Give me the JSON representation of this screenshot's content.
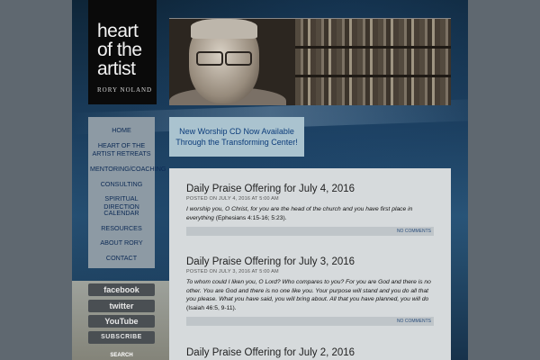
{
  "logo": {
    "title": "heart\nof the\nartist",
    "subtitle": "RORY NOLAND"
  },
  "nav": {
    "items": [
      {
        "label": "HOME"
      },
      {
        "label": "HEART OF THE ARTIST RETREATS"
      },
      {
        "label": "MENTORING/COACHING"
      },
      {
        "label": "CONSULTING"
      },
      {
        "label": "SPIRITUAL DIRECTION"
      },
      {
        "label": "CALENDAR"
      },
      {
        "label": "RESOURCES"
      },
      {
        "label": "ABOUT RORY"
      },
      {
        "label": "CONTACT"
      }
    ]
  },
  "social": {
    "facebook": "facebook",
    "twitter": "twitter",
    "youtube": "YouTube",
    "subscribe": "SUBSCRIBE",
    "search": "SEARCH"
  },
  "promo": {
    "line1": "New Worship CD Now Available",
    "line2": "Through the Transforming Center!"
  },
  "posts": [
    {
      "title": "Daily Praise Offering for July 4, 2016",
      "meta": "POSTED ON JULY 4, 2016 AT 5:00 AM",
      "body_italic": "I worship you, O Christ, for you are the head of the church and you have first place in everything",
      "body_ref": " (Ephesians 4:15-16; 5:23).",
      "comments": "NO COMMENTS"
    },
    {
      "title": "Daily Praise Offering for July 3, 2016",
      "meta": "POSTED ON JULY 3, 2016 AT 5:00 AM",
      "body_italic": "To whom could I liken you, O Lord? Who compares to you? For you are God and there is no other. You are God and there is no one like you. Your purpose will stand and you do all that you please. What you have said, you will bring about. All that you have planned, you will do",
      "body_ref": " (Isaiah 46:5, 9-11).",
      "comments": "NO COMMENTS"
    },
    {
      "title": "Daily Praise Offering for July 2, 2016"
    }
  ]
}
